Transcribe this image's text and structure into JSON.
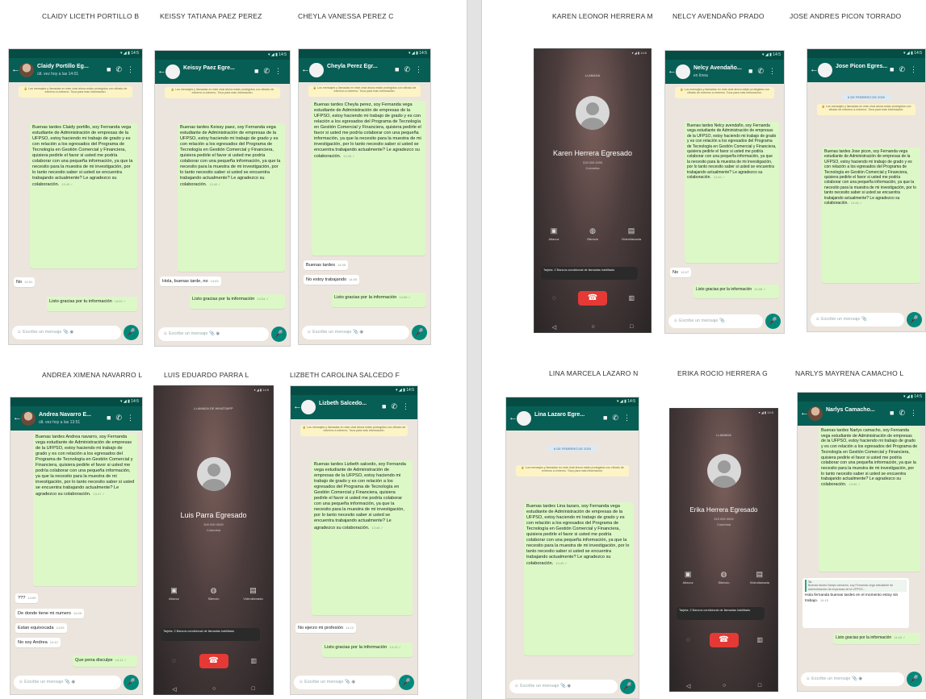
{
  "captions": {
    "c1": "CLAIDY LICETH PORTILLO B",
    "c2": "KEISSY TATIANA PAEZ PEREZ",
    "c3": "CHEYLA VANESSA PEREZ C",
    "c4": "KAREN LEONOR HERRERA M",
    "c5": "NELCY AVENDAÑO PRADO",
    "c6": "JOSE ANDRES PICON TORRADO",
    "c7": "ANDREA XIMENA NAVARRO L",
    "c8": "LUIS EDUARDO PARRA L",
    "c9": "LIZBETH CAROLINA SALCEDO F",
    "c10": "LINA MARCELA LAZARO N",
    "c11": "ERIKA ROCIO HERRERA G",
    "c12": "NARLYS MAYRENA CAMACHO L"
  },
  "common": {
    "status_bar": "▾ ◢ ▮ 14:5",
    "encryption_notice": "🔒 Los mensajes y llamadas en este chat ahora están protegidos con cifrado de extremo a extremo. Toca para más información.",
    "date_badge": "6 DE FEBRERO DE 2020",
    "input_placeholder": "Escribe un mensaje",
    "mic_icon": "🎤",
    "call_status": "LLAMADA",
    "call_tip": "Tarjeta: 2 Bancos condicional de llamadas habilitado"
  },
  "chat1": {
    "contact": "Claidy Portillo Eg...",
    "last_seen": "últ. vez hoy a las 14:01",
    "message": "Buenas tardes Claidy portillo, soy Fernanda vega estudiante de Administración de empresas de la UFPSO, estoy haciendo mi trabajo de grado y es con relación a los egresados del Programa de Tecnología en Gestión Comercial y Financiera, quisiera pedirle el favor si usted me podría colaborar con una pequeña información, ya que la necesito para la muestra de mi investigación, por lo tanto necesito saber si usted se encuentra trabajando actualmente? Le agradezco su colaboración.",
    "msg_time": "13:45 ✓",
    "reply1": "No",
    "reply1_time": "14:01",
    "thanks": "Listo gracias por tu información",
    "thanks_time": "14:02 ✓"
  },
  "chat2": {
    "contact": "Keissy Paez Egre...",
    "message": "Buenas tardes Keissy paez, soy Fernanda vega estudiante de Administración de empresas de la UFPSO, estoy haciendo mi trabajo de grado y es con relación a los egresados del Programa de Tecnología en Gestión Comercial y Financiera, quisiera pedirle el favor si usted me podría colaborar con una pequeña información, ya que la necesito para la muestra de mi investigación, por lo tanto necesito saber si usted se encuentra trabajando actualmente? Le agradezco su colaboración.",
    "msg_time": "13:45 ✓",
    "reply1": "Hola, buenas tarde, no",
    "reply1_time": "14:03",
    "thanks": "Listo gracias por la información",
    "thanks_time": "14:04 ✓"
  },
  "chat3": {
    "contact": "Cheyla Perez Egr...",
    "message": "Buenas tardes Cheyla perez, soy Fernanda vega estudiante de Administración de empresas de la UFPSO, estoy haciendo mi trabajo de grado y es con relación a los egresados del Programa de Tecnología en Gestión Comercial y Financiera, quisiera pedirle el favor si usted me podría colaborar con una pequeña información, ya que la necesito para la muestra de mi investigación, por lo tanto necesito saber si usted se encuentra trabajando actualmente? Le agradezco su colaboración.",
    "msg_time": "13:45 ✓",
    "reply1": "Buenas tardes",
    "reply1_time": "14:05",
    "reply2": "No estoy trabajando",
    "reply2_time": "14:05",
    "thanks": "Listo gracias por la información",
    "thanks_time": "14:06 ✓"
  },
  "call4": {
    "name": "Karen Herrera Egresado",
    "number": "315 000 0000",
    "country": "Colombia",
    "a1": "Altavoz",
    "a2": "Silencio",
    "a3": "Videollamada"
  },
  "chat5": {
    "contact": "Nelcy Avendaño...",
    "last_seen": "en línea",
    "message": "Buenas tardes Nelcy avendaño, soy Fernanda vega estudiante de Administración de empresas de la UFPSO, estoy haciendo mi trabajo de grado y es con relación a los egresados del Programa de Tecnología en Gestión Comercial y Financiera, quisiera pedirle el favor si usted me podría colaborar con una pequeña información, ya que la necesito para la muestra de mi investigación, por lo tanto necesito saber si usted se encuentra trabajando actualmente? Le agradezco su colaboración.",
    "msg_time": "13:46 ✓",
    "reply1": "No",
    "reply1_time": "14:07",
    "thanks": "Listo gracias por la información",
    "thanks_time": "14:08 ✓"
  },
  "chat6": {
    "contact": "Jose Picon Egres...",
    "message": "Buenas tardes Jose picon, soy Fernanda vega estudiante de Administración de empresas de la UFPSO, estoy haciendo mi trabajo de grado y es con relación a los egresados del Programa de Tecnología en Gestión Comercial y Financiera, quisiera pedirle el favor si usted me podría colaborar con una pequeña información, ya que la necesito para la muestra de mi investigación, por lo tanto necesito saber si usted se encuentra trabajando actualmente? Le agradezco su colaboración.",
    "msg_time": "13:46 ✓"
  },
  "chat7": {
    "contact": "Andrea Navarro E...",
    "last_seen": "últ. vez hoy a las 13:51",
    "message": "Buenas tardes Andrea navarro, soy Fernanda vega estudiante de Administración de empresas de la UFPSO, estoy haciendo mi trabajo de grado y es con relación a los egresados del Programa de Tecnología en Gestión Comercial y Financiera, quisiera pedirle el favor si usted me podría colaborar con una pequeña información, ya que la necesito para la muestra de mi investigación, por lo tanto necesito saber si usted se encuentra trabajando actualmente? Le agradezco su colaboración.",
    "msg_time": "13:47 ✓",
    "reply1": "???",
    "reply1_time": "14:09",
    "reply2": "De donde tiene mi numero",
    "reply2_time": "14:09",
    "reply3": "Estan equivocada",
    "reply3_time": "14:09",
    "reply4": "No soy Andrea",
    "reply4_time": "14:10",
    "sorry": "Que pena disculpe",
    "sorry_time": "14:11 ✓"
  },
  "call8": {
    "status": "LLAMADA DE WHATSAPP",
    "name": "Luis Parra Egresado",
    "number": "300 000 0000",
    "country": "Colombia",
    "a1": "Altavoz",
    "a2": "Silencio",
    "a3": "Videollamada"
  },
  "chat9": {
    "contact": "Lizbeth Salcedo...",
    "message": "Buenas tardes Lizbeth salcedo, soy Fernanda vega estudiante de Administración de empresas de la UFPSO, estoy haciendo mi trabajo de grado y es con relación a los egresados del Programa de Tecnología en Gestión Comercial y Financiera, quisiera pedirle el favor si usted me podría colaborar con una pequeña información, ya que la necesito para la muestra de mi investigación, por lo tanto necesito saber si usted se encuentra trabajando actualmente? Le agradezco su colaboración.",
    "msg_time": "13:48 ✓",
    "reply1": "No ejerzo mi profesión",
    "reply1_time": "14:12",
    "thanks": "Listo gracias por la información",
    "thanks_time": "14:13 ✓"
  },
  "chat10": {
    "contact": "Lina Lazaro Egre...",
    "message": "Buenas tardes Lina lazaro, soy Fernanda vega estudiante de Administración de empresas de la UFPSO, estoy haciendo mi trabajo de grado y es con relación a los egresados del Programa de Tecnología en Gestión Comercial y Financiera, quisiera pedirle el favor si usted me podría colaborar con una pequeña información, ya que la necesito para la muestra de mi investigación, por lo tanto necesito saber si usted se encuentra trabajando actualmente? Le agradezco su colaboración.",
    "msg_time": "13:49 ✓"
  },
  "call11": {
    "name": "Erika Herrera Egresado",
    "number": "310 000 0000",
    "country": "Colombia",
    "a1": "Altavoz",
    "a2": "Silencio",
    "a3": "Videollamada"
  },
  "chat12": {
    "contact": "Narlys Camacho...",
    "message": "Buenas tardes Narlys camacho, soy Fernanda vega estudiante de Administración de empresas de la UFPSO, estoy haciendo mi trabajo de grado y es con relación a los egresados del Programa de Tecnología en Gestión Comercial y Financiera, quisiera pedirle el favor si usted me podría colaborar con una pequeña información, ya que la necesito para la muestra de mi investigación, por lo tanto necesito saber si usted se encuentra trabajando actualmente? Le agradezco su colaboración.",
    "msg_time": "13:50 ✓",
    "quote_author": "Tú",
    "quote_text": "Buenas tardes Narlys camacho, soy Fernanda vega estudiante de Administración de empresas de la UFPSO...",
    "reply1": "Hola fernanda buenas tardes en el momento estoy sin trabajo.",
    "reply1_time": "14:15",
    "thanks": "Listo gracias por la información",
    "thanks_time": "14:16 ✓"
  },
  "colors": {
    "whatsapp_header": "#075e54",
    "outgoing_bubble": "#dcf8c6",
    "chat_background": "#ece5dd",
    "end_call": "#e53935",
    "mic_button": "#00897b"
  },
  "icons": {
    "back": "←",
    "video": "■",
    "phone": "✆",
    "menu": "⋮",
    "end_call": "☎",
    "speaker": "▣",
    "mute": "◍",
    "videocall": "▤"
  }
}
